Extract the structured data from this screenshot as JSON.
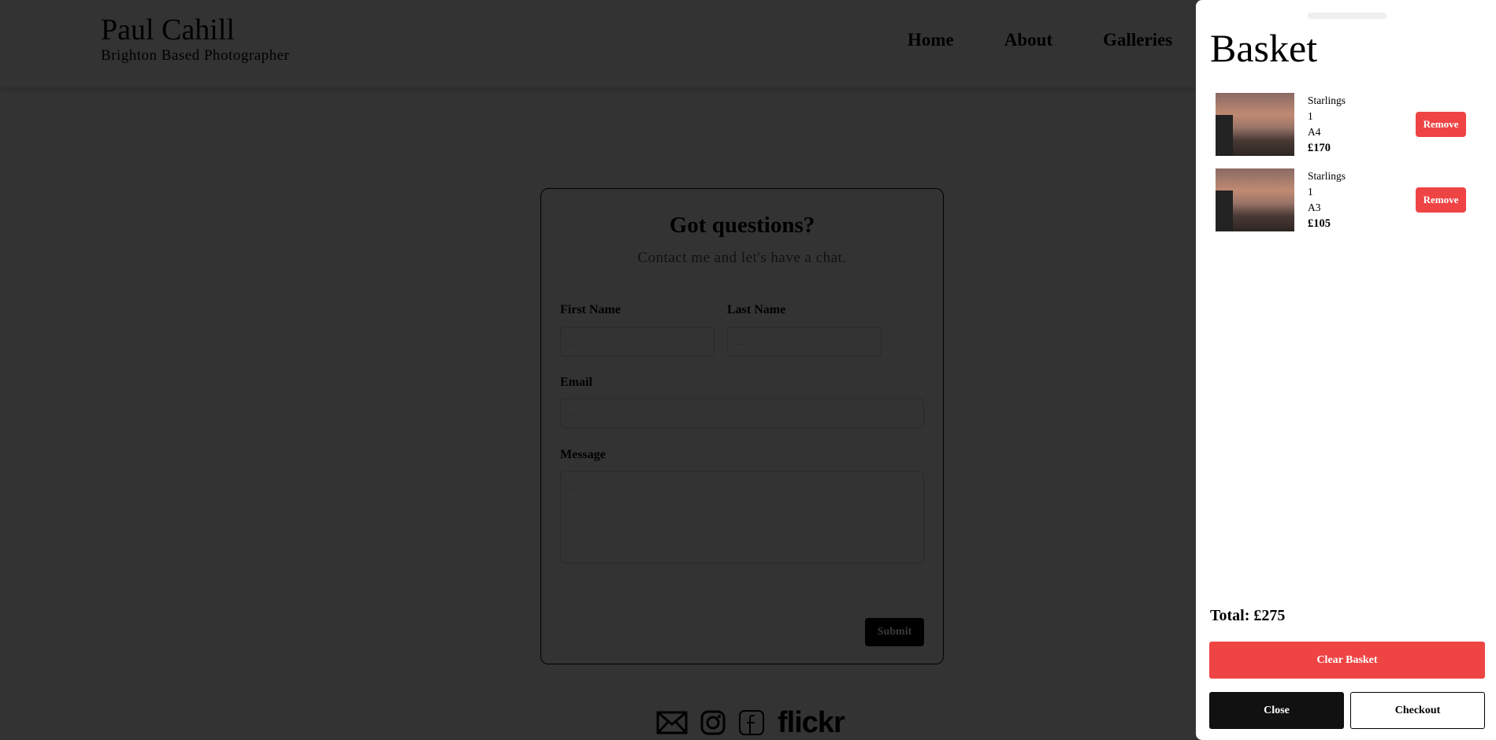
{
  "header": {
    "name": "Paul Cahill",
    "tagline": "Brighton Based Photographer",
    "nav": [
      "Home",
      "About",
      "Galleries"
    ]
  },
  "form": {
    "title": "Got questions?",
    "subtitle": "Contact me and let's have a chat.",
    "first_name_label": "First Name",
    "last_name_label": "Last Name",
    "email_label": "Email",
    "message_label": "Message",
    "placeholder": "...",
    "submit_label": "Submit"
  },
  "social": {
    "icons": [
      "mail-icon",
      "instagram-icon",
      "facebook-icon",
      "flickr-logo"
    ],
    "flickr": "flickr"
  },
  "basket": {
    "title": "Basket",
    "items": [
      {
        "name": "Starlings",
        "quantity": "1",
        "size": "A4",
        "price": "£170"
      },
      {
        "name": "Starlings",
        "quantity": "1",
        "size": "A3",
        "price": "£105"
      }
    ],
    "remove_label": "Remove",
    "total": "Total: £275",
    "clear_label": "Clear Basket",
    "close_label": "Close",
    "checkout_label": "Checkout"
  },
  "colors": {
    "danger": "#ef4444",
    "dark": "#111111"
  }
}
